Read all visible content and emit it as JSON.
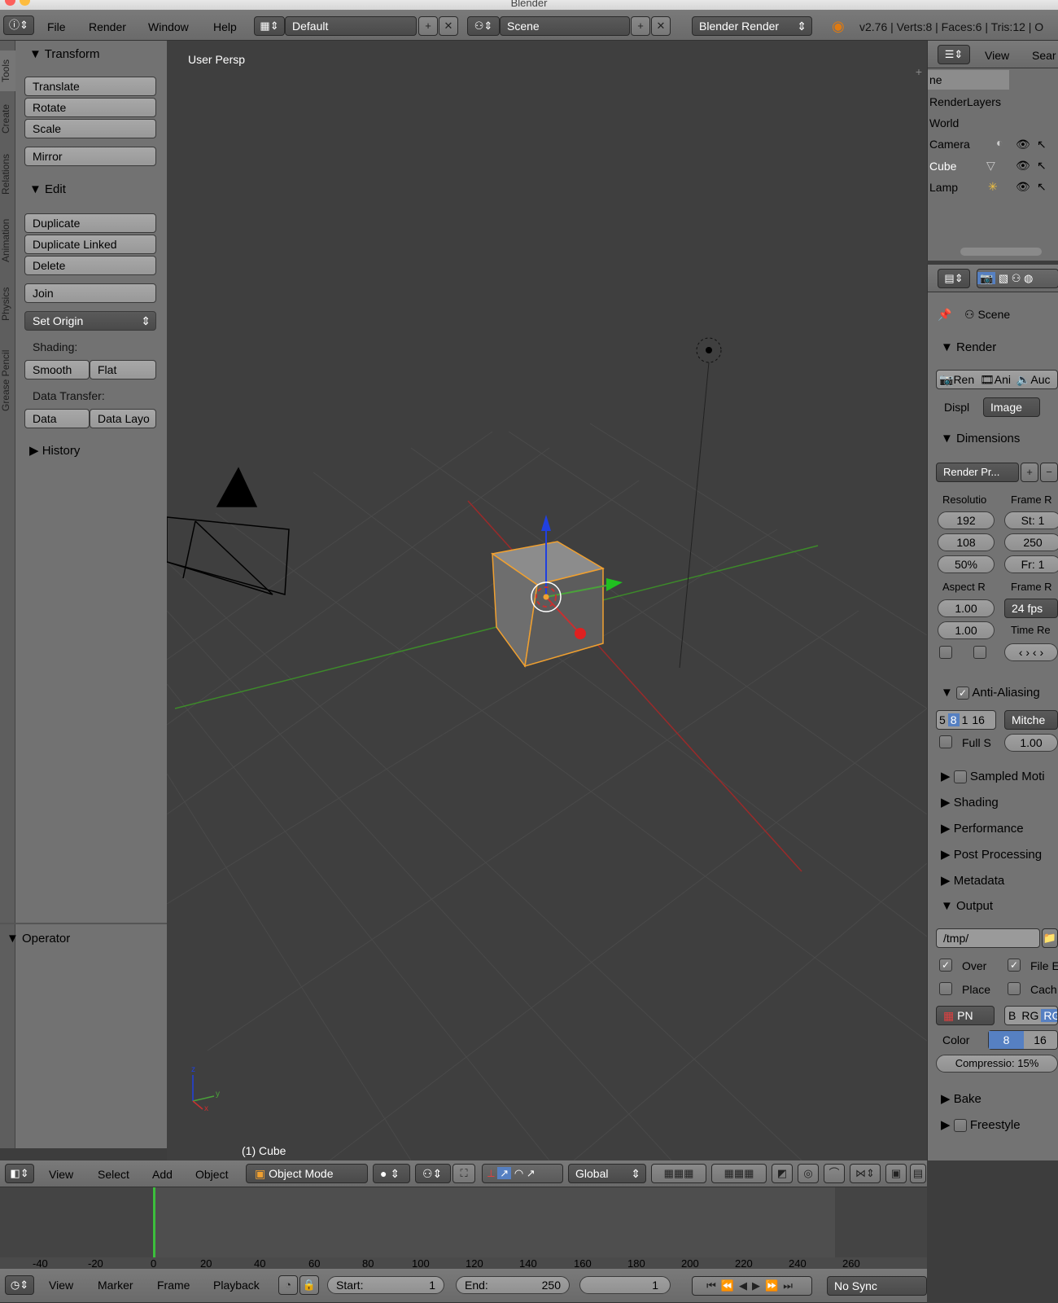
{
  "window": {
    "title": "Blender"
  },
  "topbar": {
    "menus": [
      "File",
      "Render",
      "Window",
      "Help"
    ],
    "layout": "Default",
    "scene": "Scene",
    "engine": "Blender Render",
    "stats": "v2.76 | Verts:8 | Faces:6 | Tris:12 | O"
  },
  "toolshelf": {
    "tabs": [
      "Tools",
      "Create",
      "Relations",
      "Animation",
      "Physics",
      "Grease Pencil"
    ],
    "transform": {
      "title": "Transform",
      "translate": "Translate",
      "rotate": "Rotate",
      "scale": "Scale",
      "mirror": "Mirror"
    },
    "edit": {
      "title": "Edit",
      "duplicate": "Duplicate",
      "duplicate_linked": "Duplicate Linked",
      "delete": "Delete",
      "join": "Join",
      "set_origin": "Set Origin"
    },
    "shading": {
      "label": "Shading:",
      "smooth": "Smooth",
      "flat": "Flat"
    },
    "data_transfer": {
      "label": "Data Transfer:",
      "data": "Data",
      "data_layout": "Data Layo"
    },
    "history": "History",
    "operator": "Operator"
  },
  "viewport": {
    "mode_label": "User Persp",
    "object_label": "(1) Cube"
  },
  "viewport_header": {
    "menus": [
      "View",
      "Select",
      "Add",
      "Object"
    ],
    "mode": "Object Mode",
    "orientation": "Global"
  },
  "outliner": {
    "view": "View",
    "search": "Sear",
    "items": [
      "ne",
      "RenderLayers",
      "World",
      "Camera",
      "Cube",
      "Lamp"
    ]
  },
  "properties": {
    "scene": "Scene",
    "render": {
      "title": "Render",
      "buttons": [
        "Ren",
        "Ani",
        "Auc"
      ],
      "display_label": "Displ",
      "display_value": "Image"
    },
    "dimensions": {
      "title": "Dimensions",
      "preset": "Render Pr...",
      "resolution_label": "Resolutio",
      "res_x": "192",
      "res_y": "108",
      "res_pct": "50%",
      "frame_range_label": "Frame R",
      "start": "St: 1",
      "end": "250",
      "frame": "Fr: 1",
      "aspect_label": "Aspect R",
      "aspect_x": "1.00",
      "aspect_y": "1.00",
      "frame_rate_label": "Frame R",
      "fps": "24 fps",
      "time_remap_label": "Time Re"
    },
    "anti_aliasing": {
      "title": "Anti-Aliasing",
      "samples": [
        "5",
        "8",
        "1",
        "16"
      ],
      "filter": "Mitche",
      "full_sample": "Full S",
      "size": "1.00"
    },
    "collapsed": [
      "Sampled Moti",
      "Shading",
      "Performance",
      "Post Processing",
      "Metadata"
    ],
    "output": {
      "title": "Output",
      "path": "/tmp/",
      "overwrite": "Over",
      "file_ext": "File E",
      "placeholders": "Place",
      "cache": "Cach",
      "format": "PN",
      "bw": "B",
      "rgb": "RG",
      "rgba": "RG",
      "color_label": "Color",
      "depth8": "8",
      "depth16": "16",
      "compression": "Compressio: 15%"
    },
    "bake": "Bake",
    "freestyle": "Freestyle"
  },
  "timeline": {
    "ruler": [
      "-40",
      "-20",
      "0",
      "20",
      "40",
      "60",
      "80",
      "100",
      "120",
      "140",
      "160",
      "180",
      "200",
      "220",
      "240",
      "260"
    ],
    "current_frame_value": 0,
    "menus": [
      "View",
      "Marker",
      "Frame",
      "Playback"
    ],
    "start_label": "Start:",
    "start": "1",
    "end_label": "End:",
    "end": "250",
    "current": "1",
    "sync": "No Sync"
  },
  "colors": {
    "accent_blue": "#5680c2",
    "selection_orange": "#f0a030",
    "x_axis": "#c83030",
    "y_axis": "#4aa23a",
    "z_axis": "#2040e0"
  }
}
